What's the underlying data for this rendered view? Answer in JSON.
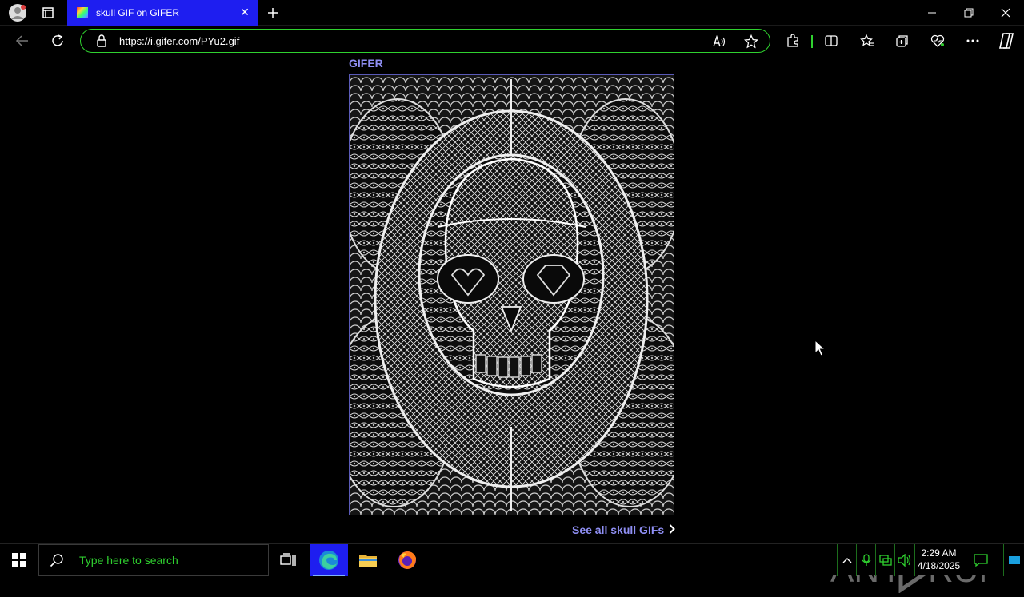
{
  "browser": {
    "tab_title": "skull GIF on GIFER",
    "url": "https://i.gifer.com/PYu2.gif",
    "accent_color": "#1e1ef0",
    "omnibox_border_color": "#2fd12f"
  },
  "page": {
    "site_label": "GIFER",
    "see_all_link": "See all skull GIFs",
    "link_color": "#8f8ff4",
    "image_description_icon": "skull-lace-gif"
  },
  "watermark": {
    "text_left": "ANY",
    "text_right": "RUN"
  },
  "taskbar": {
    "search_placeholder": "Type here to search",
    "time": "2:29 AM",
    "date": "4/18/2025"
  }
}
